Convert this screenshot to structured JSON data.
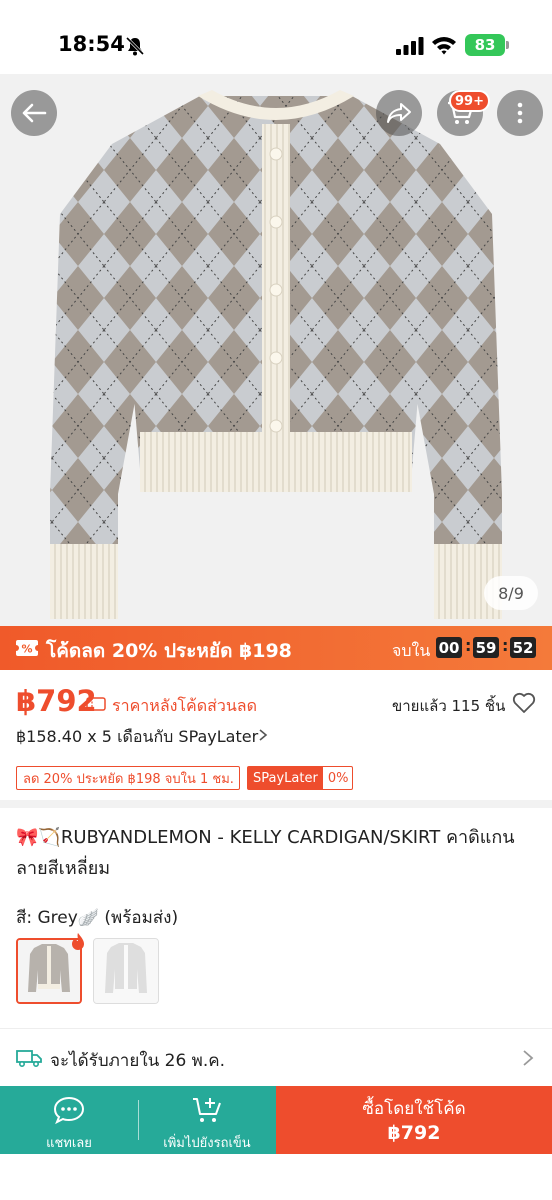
{
  "status_bar": {
    "time": "18:54",
    "battery": "83"
  },
  "colors": {
    "brand": "#ee4d2d",
    "teal": "#26aa99"
  },
  "hero": {
    "cart_badge": "99+",
    "image_counter": "8/9"
  },
  "deal": {
    "text": "โค้ดลด 20% ประหยัด ฿198",
    "ends_label": "จบใน",
    "hours": "00",
    "minutes": "59",
    "seconds": "52"
  },
  "price": {
    "amount": "฿792",
    "note": "ราคาหลังโค้ดส่วนลด",
    "sold": "ขายแล้ว 115 ชิ้น",
    "installment": "฿158.40 x 5 เดือนกับ SPayLater",
    "discount_chip": "ลด 20% ประหยัด ฿198 จบใน 1 ชม.",
    "spay_tag": "SPayLater",
    "spay_pct": "0%"
  },
  "product": {
    "title": "🎀🏹RUBYANDLEMON - KELLY CARDIGAN/SKIRT คาดิแกนลายสีเหลี่ยม",
    "variant_label": "สี: Grey🪽 (พร้อมส่ง)"
  },
  "delivery": {
    "text": "จะได้รับภายใน 26 พ.ค."
  },
  "bottom_bar": {
    "chat_label": "แชทเลย",
    "cart_label": "เพิ่มไปยังรถเข็น",
    "buy_label": "ซื้อโดยใช้โค้ด",
    "buy_price": "฿792"
  }
}
